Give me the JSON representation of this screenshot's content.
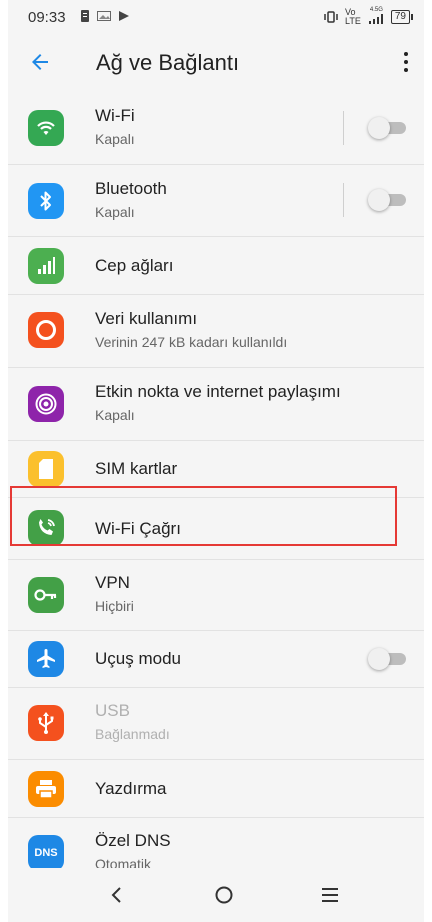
{
  "status_bar": {
    "time": "09:33",
    "network_label_top": "Vo",
    "network_label_bottom": "LTE",
    "signal_label": "4.5G",
    "battery": "79"
  },
  "app_bar": {
    "title": "Ağ ve Bağlantı",
    "back_icon": "arrow-back-icon",
    "menu_icon": "more-vert-icon"
  },
  "items": [
    {
      "title": "Wi-Fi",
      "subtitle": "Kapalı",
      "icon": "wifi-icon",
      "color": "#34a853",
      "toggle": false
    },
    {
      "title": "Bluetooth",
      "subtitle": "Kapalı",
      "icon": "bluetooth-icon",
      "color": "#2196f3",
      "toggle": false
    },
    {
      "title": "Cep ağları",
      "icon": "signal-bars-icon",
      "color": "#4caf50"
    },
    {
      "title": "Veri kullanımı",
      "subtitle": "Verinin 247 kB kadarı kullanıldı",
      "icon": "data-usage-icon",
      "color": "#f4511e"
    },
    {
      "title": "Etkin nokta ve internet paylaşımı",
      "subtitle": "Kapalı",
      "icon": "hotspot-icon",
      "color": "#8e24aa"
    },
    {
      "title": "SIM kartlar",
      "icon": "sim-card-icon",
      "color": "#fbc02d"
    },
    {
      "title": "Wi-Fi Çağrı",
      "icon": "wifi-calling-icon",
      "color": "#43a047"
    },
    {
      "title": "VPN",
      "subtitle": "Hiçbiri",
      "icon": "vpn-key-icon",
      "color": "#43a047"
    },
    {
      "title": "Uçuş modu",
      "icon": "airplane-icon",
      "color": "#1e88e5",
      "toggle": false
    },
    {
      "title": "USB",
      "subtitle": "Bağlanmadı",
      "icon": "usb-icon",
      "color": "#f4511e",
      "disabled": true
    },
    {
      "title": "Yazdırma",
      "icon": "printer-icon",
      "color": "#fb8c00"
    },
    {
      "title": "Özel DNS",
      "subtitle": "Otomatik",
      "icon": "dns-icon",
      "icon_text": "DNS",
      "color": "#1e88e5"
    }
  ],
  "highlight": {
    "color": "#e53935",
    "target": "Wi-Fi Çağrı"
  },
  "nav_bar": {
    "back": "nav-back-icon",
    "home": "nav-home-icon",
    "recents": "nav-menu-icon"
  }
}
